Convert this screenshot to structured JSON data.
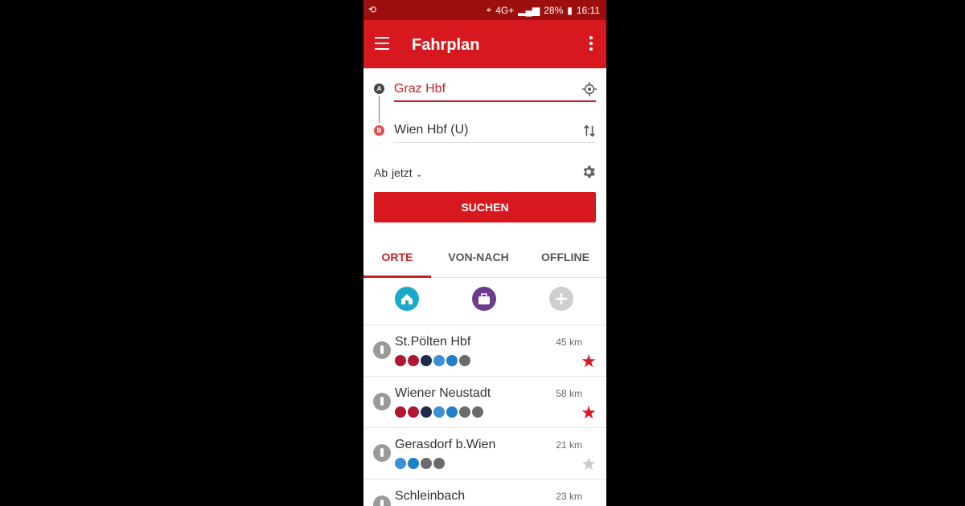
{
  "status": {
    "battery": "28%",
    "time": "16:11",
    "network": "4G+"
  },
  "app": {
    "title": "Fahrplan"
  },
  "form": {
    "from": "Graz Hbf",
    "to": "Wien Hbf (U)",
    "marker_a": "A",
    "marker_b": "B",
    "ab_label": "Ab",
    "when": "jetzt",
    "search_button": "SUCHEN"
  },
  "tabs": [
    {
      "label": "ORTE"
    },
    {
      "label": "VON-NACH"
    },
    {
      "label": "OFFLINE"
    }
  ],
  "quick_icons": [
    {
      "name": "home-icon",
      "color": "#19a9c9"
    },
    {
      "name": "work-icon",
      "color": "#6c3c8f"
    },
    {
      "name": "add-icon",
      "color": "#cfcfcf"
    }
  ],
  "places": [
    {
      "name": "St.Pölten Hbf",
      "distance": "45 km",
      "favorite": true,
      "modes": [
        "train",
        "train",
        "bus",
        "tram",
        "sbahn",
        "bus-gray"
      ]
    },
    {
      "name": "Wiener Neustadt",
      "distance": "58 km",
      "favorite": true,
      "modes": [
        "train",
        "train",
        "bus",
        "tram",
        "sbahn",
        "bus-gray",
        "other"
      ]
    },
    {
      "name": "Gerasdorf b.Wien",
      "distance": "21 km",
      "favorite": false,
      "modes": [
        "tram",
        "sbahn",
        "bus-gray",
        "other"
      ]
    },
    {
      "name": "Schleinbach",
      "distance": "23 km",
      "favorite": false,
      "modes": []
    }
  ],
  "colors": {
    "brand": "#d8181f",
    "statusbar": "#9d0f0f",
    "accent": "#c72026",
    "train": "#b01733",
    "bus": "#1e2b4a",
    "tram": "#3f8fd6",
    "sbahn": "#1f7fc9",
    "gray": "#6b6b6b"
  }
}
